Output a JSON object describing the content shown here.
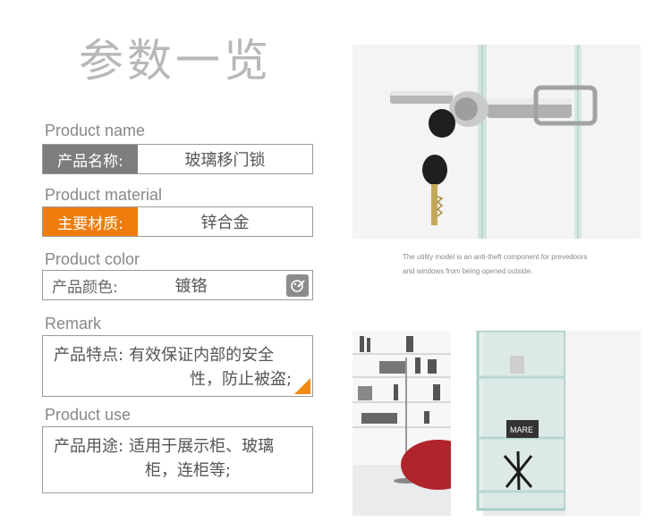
{
  "title": "参数一览",
  "fields": [
    {
      "en": "Product name",
      "label": "产品名称:",
      "value": "玻璃移门锁"
    },
    {
      "en": "Product material",
      "label": "主要材质:",
      "value": "锌合金"
    },
    {
      "en": "Product color",
      "label": "产品颜色:",
      "value": "镀铬"
    },
    {
      "en": "Remark",
      "label": "产品特点:",
      "value_line1": "有效保证内部的安全",
      "value_line2": "性，防止被盗;"
    },
    {
      "en": "Product use",
      "label": "产品用途:",
      "value_line1": "适用于展示柜、玻璃",
      "value_line2": "柜，连柜等;"
    }
  ],
  "caption_line1": "The utility model is an anti-theft component for prevedoors",
  "caption_line2": "and windows from being opened outside.",
  "photo_text": "MARE",
  "colors": {
    "label_gray": "#7d7d7d",
    "label_orange": "#ee7d0e"
  }
}
